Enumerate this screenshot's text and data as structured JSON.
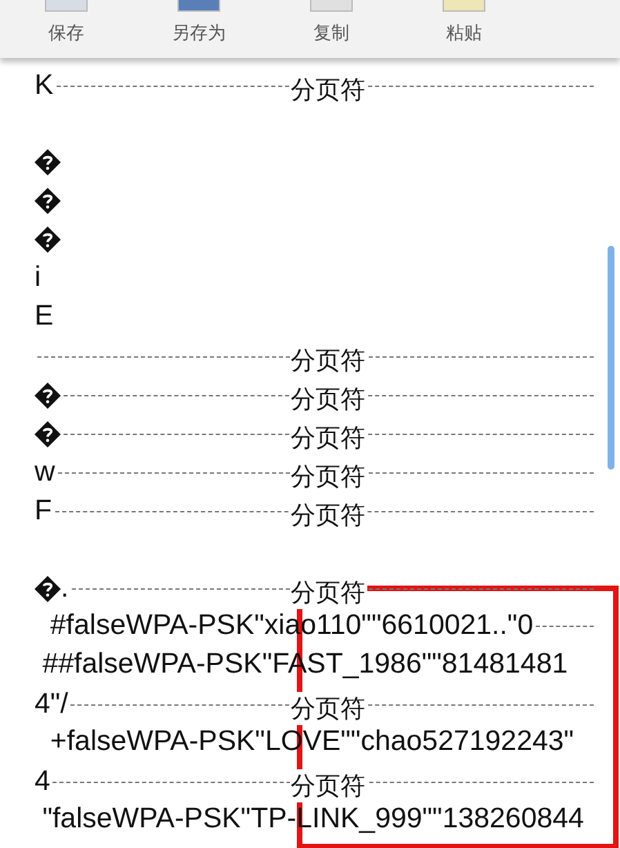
{
  "toolbar": [
    {
      "label": "保存"
    },
    {
      "label": "另存为"
    },
    {
      "label": "复制"
    },
    {
      "label": "粘贴"
    }
  ],
  "document": {
    "lines": [
      {
        "text": "K",
        "page_break": true,
        "break_label": "分页符"
      },
      {
        "page_break": false
      },
      {
        "kind": "garbled",
        "page_break": false
      },
      {
        "kind": "garbled",
        "page_break": false
      },
      {
        "kind": "garbled",
        "page_break": false
      },
      {
        "text": "i",
        "page_break": false
      },
      {
        "text": "E",
        "page_break": false
      },
      {
        "page_break": true,
        "break_label": "分页符"
      },
      {
        "kind": "garbled",
        "page_break": true,
        "break_label": "分页符"
      },
      {
        "kind": "garbled",
        "page_break": true,
        "break_label": "分页符"
      },
      {
        "text": "w",
        "page_break": true,
        "break_label": "分页符"
      },
      {
        "text": "F",
        "page_break": true,
        "break_label": "分页符"
      },
      {
        "page_break": false
      },
      {
        "kind": "garbled",
        "text": ".",
        "page_break": true,
        "break_label": "分页符"
      },
      {
        "text": "  #falseWPA-PSK\"xiao110\"\"6610021..\"0",
        "page_break": true
      },
      {
        "text": " ##falseWPA-PSK\"FAST_1986\"\"81481481",
        "page_break": false
      },
      {
        "text": "4\"/",
        "page_break": true,
        "break_label": "分页符"
      },
      {
        "text": "  +falseWPA-PSK\"LOVE\"\"chao527192243\"",
        "page_break": false
      },
      {
        "text": "4",
        "page_break": true,
        "break_label": "分页符"
      },
      {
        "text": " \"falseWPA-PSK\"TP-LINK_999\"\"138260844",
        "page_break": false
      }
    ]
  },
  "highlight": {
    "shown": true
  }
}
